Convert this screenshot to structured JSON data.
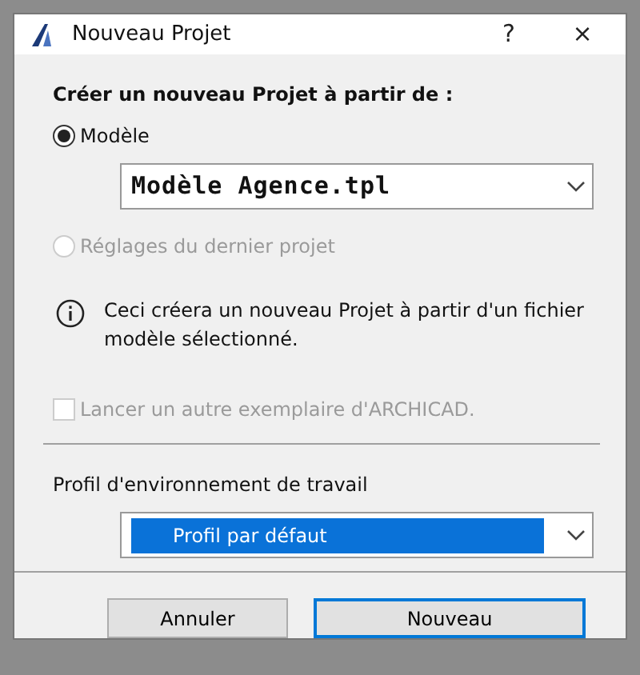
{
  "window": {
    "title": "Nouveau Projet",
    "help": "?",
    "close": "×"
  },
  "heading": "Créer un nouveau Projet à partir de :",
  "options": [
    {
      "label": "Modèle",
      "selected": true,
      "disabled": false
    },
    {
      "label": "Réglages du dernier projet",
      "selected": false,
      "disabled": true
    }
  ],
  "template_select": {
    "value": "Modèle Agence.tpl"
  },
  "info": "Ceci créera un nouveau Projet à partir d'un fichier modèle sélectionné.",
  "launch_checkbox": {
    "label": "Lancer un autre exemplaire d'ARCHICAD.",
    "checked": false,
    "disabled": true
  },
  "profile": {
    "label": "Profil d'environnement de travail",
    "value": "Profil par défaut",
    "focused": true
  },
  "buttons": [
    {
      "label": "Annuler",
      "default": false
    },
    {
      "label": "Nouveau",
      "default": true
    }
  ]
}
